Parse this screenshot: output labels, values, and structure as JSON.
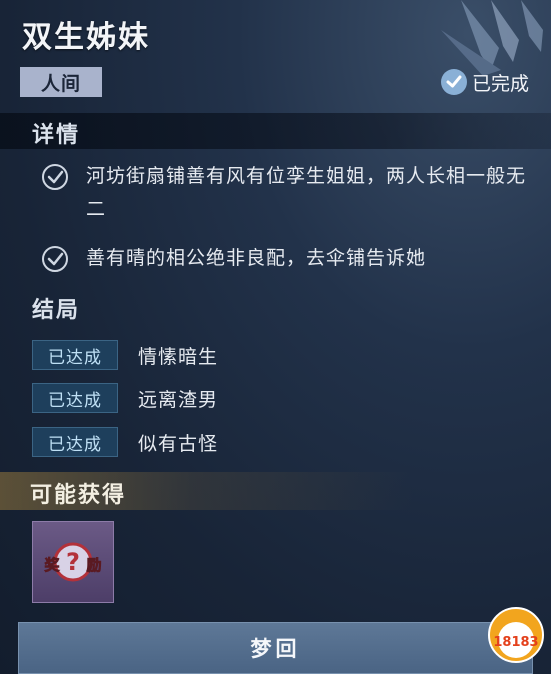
{
  "quest": {
    "title": "双生姊妹",
    "tag": "人间",
    "status": "已完成"
  },
  "details": {
    "heading": "详情",
    "items": [
      {
        "text": "河坊街扇铺善有风有位孪生姐姐，两人长相一般无二"
      },
      {
        "text": "善有晴的相公绝非良配，去伞铺告诉她"
      }
    ]
  },
  "endings": {
    "heading": "结局",
    "items": [
      {
        "badge": "已达成",
        "label": "情愫暗生"
      },
      {
        "badge": "已达成",
        "label": "远离渣男"
      },
      {
        "badge": "已达成",
        "label": "似有古怪"
      }
    ]
  },
  "rewards": {
    "heading": "可能获得",
    "item_glyph_left": "奖",
    "item_glyph_mark": "?",
    "item_glyph_right": "励"
  },
  "action": {
    "label": "梦回"
  },
  "watermark": {
    "text": "18183"
  },
  "colors": {
    "badge_bg": "#1e3f5c",
    "tag_bg": "#a9b3cc",
    "button_bg": "#5e7897",
    "reward_bg": "#6b5a86"
  }
}
